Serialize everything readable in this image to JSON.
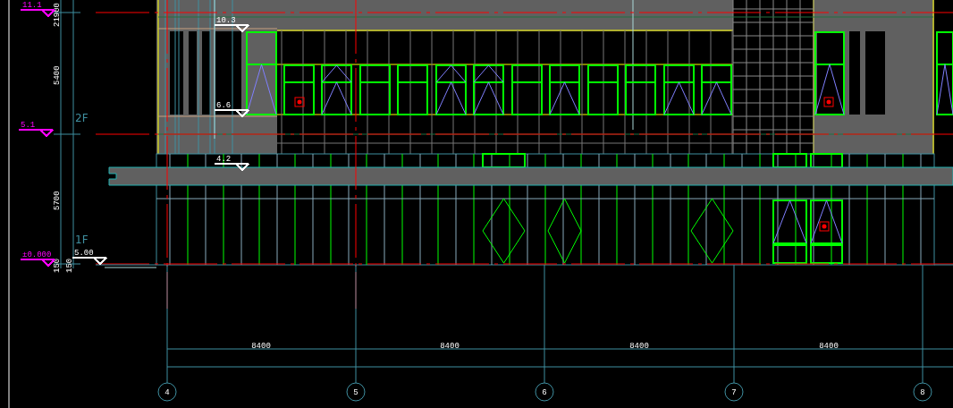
{
  "canvas": {
    "level_marks": [
      {
        "label": "11.1",
        "color": "#ff00ff"
      },
      {
        "label": "5.1",
        "color": "#ff00ff"
      },
      {
        "label": "±0.000",
        "color": "#ff00ff"
      },
      {
        "label": "10.3",
        "color": "#ffffff"
      },
      {
        "label": "6.6",
        "color": "#ffffff"
      },
      {
        "label": "4.2",
        "color": "#ffffff"
      },
      {
        "label": "5.00",
        "color": "#ffffff"
      }
    ],
    "floor_labels": [
      "2F",
      "1F"
    ],
    "vertical_dimensions": [
      "21900",
      "5400",
      "5700",
      "150",
      "150"
    ],
    "horizontal_dimensions": [
      "8400",
      "8400",
      "8400",
      "8400"
    ],
    "grid_axes": [
      "4",
      "5",
      "6",
      "7",
      "8"
    ]
  }
}
